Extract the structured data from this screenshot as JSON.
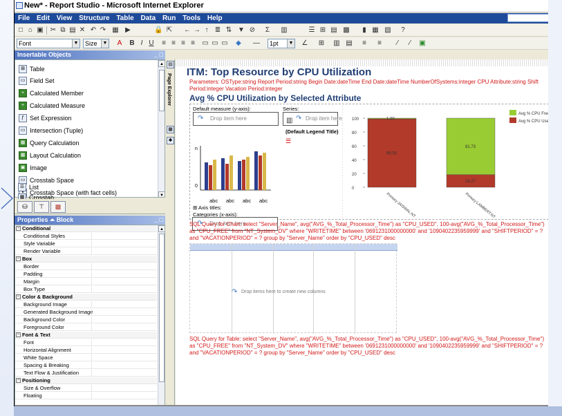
{
  "window": {
    "title": "New* - Report Studio - Microsoft Internet Explorer"
  },
  "menubar": {
    "items": [
      "File",
      "Edit",
      "View",
      "Structure",
      "Table",
      "Data",
      "Run",
      "Tools",
      "Help"
    ]
  },
  "toolbar2": {
    "font_value": "Font",
    "size_value": "Size",
    "line_width": "1pt"
  },
  "insertable": {
    "title": "Insertable Objects",
    "items": [
      {
        "label": "Table",
        "icon": "table-icon"
      },
      {
        "label": "Field Set",
        "icon": "field-set-icon"
      },
      {
        "label": "Calculated Member",
        "icon": "calculated-member-icon"
      },
      {
        "label": "Calculated Measure",
        "icon": "calculated-measure-icon"
      },
      {
        "label": "Set Expression",
        "icon": "set-expression-icon"
      },
      {
        "label": "Intersection (Tuple)",
        "icon": "intersection-icon"
      },
      {
        "label": "Query Calculation",
        "icon": "query-calculation-icon"
      },
      {
        "label": "Layout Calculation",
        "icon": "layout-calculation-icon"
      },
      {
        "label": "Image",
        "icon": "image-icon"
      },
      {
        "label": "Crosstab Space",
        "icon": "crosstab-space-icon"
      },
      {
        "label": "Crosstab Space (with fact cells)",
        "icon": "crosstab-space-fact-icon"
      },
      {
        "label": "List",
        "icon": "list-icon"
      },
      {
        "label": "Crosstab",
        "icon": "crosstab-icon"
      }
    ]
  },
  "properties": {
    "title": "Properties",
    "context": "Block",
    "rows": [
      {
        "type": "section",
        "label": "Conditional"
      },
      {
        "type": "item",
        "label": "Conditional Styles"
      },
      {
        "type": "item",
        "label": "Style Variable"
      },
      {
        "type": "item",
        "label": "Render Variable"
      },
      {
        "type": "section",
        "label": "Box"
      },
      {
        "type": "item",
        "label": "Border"
      },
      {
        "type": "item",
        "label": "Padding"
      },
      {
        "type": "item",
        "label": "Margin"
      },
      {
        "type": "item",
        "label": "Box Type"
      },
      {
        "type": "section",
        "label": "Color & Background"
      },
      {
        "type": "item",
        "label": "Background Image"
      },
      {
        "type": "item",
        "label": "Generated Background Image"
      },
      {
        "type": "item",
        "label": "Background Color"
      },
      {
        "type": "item",
        "label": "Foreground Color"
      },
      {
        "type": "section",
        "label": "Font & Text"
      },
      {
        "type": "item",
        "label": "Font"
      },
      {
        "type": "item",
        "label": "Horizontal Alignment"
      },
      {
        "type": "item",
        "label": "White Space"
      },
      {
        "type": "item",
        "label": "Spacing & Breaking"
      },
      {
        "type": "item",
        "label": "Text Flow & Justification"
      },
      {
        "type": "section",
        "label": "Positioning"
      },
      {
        "type": "item",
        "label": "Size & Overflow"
      },
      {
        "type": "item",
        "label": "Floating"
      }
    ]
  },
  "sidestrip": {
    "label": "Page Explorer"
  },
  "report": {
    "title": "ITM: Top Resource by CPU Utilization",
    "parameters": "Parameters: OSType:string Report Period:string Begin Date:dateTime End Date:dateTime NumberOfSystems:integer CPU Attribute:string Shift Period:integer Vacation Period:integer",
    "chart_title": "Avg % CPU Utilization by Selected Attribute",
    "default_measure_label": "Default measure (y-axis):",
    "series_label": "Series:",
    "categories_label": "Categories (x-axis):",
    "drop_item_here": "Drop item here",
    "default_legend_title": "(Default Legend Title)",
    "axis_titles": "Axis titles:",
    "mini_categories": [
      "abc",
      "abc",
      "abc",
      "abc"
    ],
    "sql_chart": "SQL Query for Chart: select \"Server_Name\", avg(\"AVG_%_Total_Processor_Time\") as \"CPU_USED\", 100-avg(\"AVG_%_Total_Processor_Time\") as \"CPU_FREE\" from \"NT_System_DV\" where \"WRITETIME\" between '0691231000000000' and '1090402235959999' and \"SHIFTPERIOD\" = ? and \"VACATIONPERIOD\" = ? group by \"Server_Name\" order by \"CPU_USED\" desc",
    "drop_columns": "Drop items here to create new columns",
    "sql_table": "SQL Query for Table: select \"Server_Name\", avg(\"AVG_%_Total_Processor_Time\") as \"CPU_USED\", 100-avg(\"AVG_%_Total_Processor_Time\") as \"CPU_FREE\" from \"NT_System_DV\" where \"WRITETIME\" between '0691231000000000' and '1090402235959999' and \"SHIFTPERIOD\" = ? and \"VACATIONPERIOD\" = ? group by \"Server_Name\" order by \"CPU_USED\" desc"
  },
  "chart_data": {
    "type": "bar",
    "stacked": true,
    "categories": [
      "Primary:JAISWAL:NT",
      "Primary:LAMBERT:NT"
    ],
    "series": [
      {
        "name": "Avg % CPU Free",
        "color": "#99cc33",
        "values": [
          1.0,
          81.73
        ]
      },
      {
        "name": "Avg % CPU Used",
        "color": "#b23a2a",
        "values": [
          99.0,
          18.27
        ]
      }
    ],
    "value_labels": [
      [
        "1.00",
        "99.00"
      ],
      [
        "81.73",
        "18.27"
      ]
    ],
    "y_ticks": [
      "100",
      "80",
      "60",
      "40",
      "20",
      "0"
    ],
    "ylim": [
      0,
      100
    ],
    "grid": false,
    "legend": "top-right"
  },
  "colors": {
    "report_title": "#1f3d73",
    "sql_text": "#d21818",
    "menubar": "#1e4a9a",
    "panel_header": "#4f73c0"
  }
}
